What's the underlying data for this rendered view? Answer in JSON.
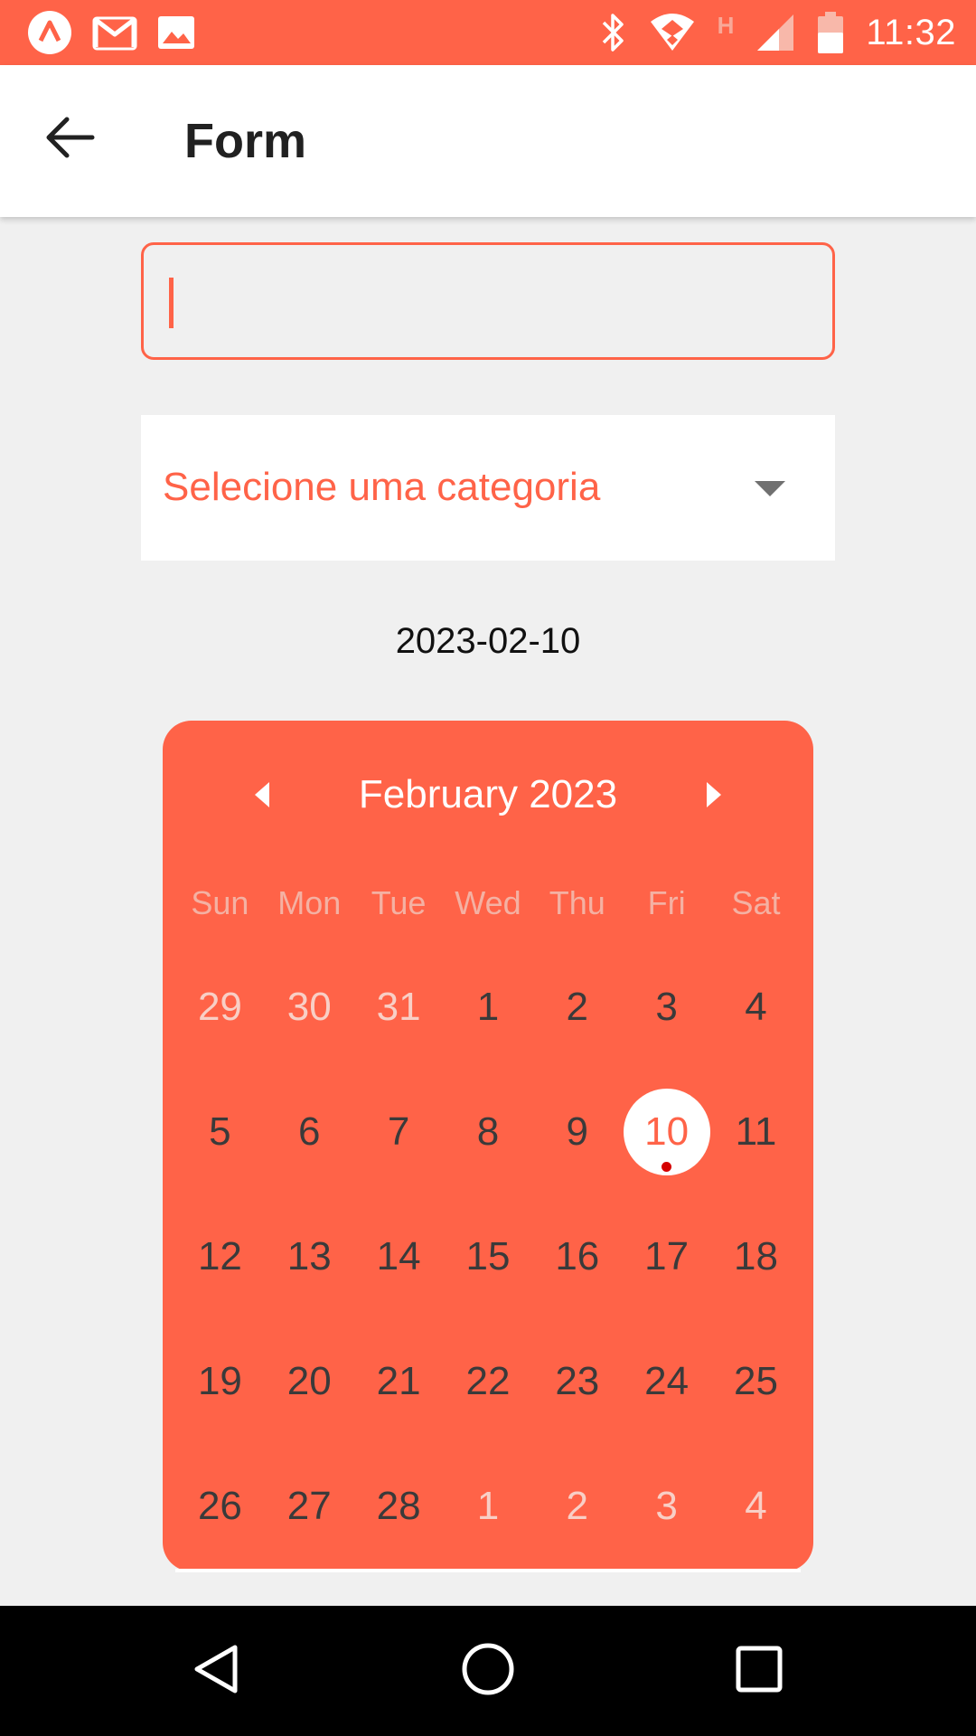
{
  "status_bar": {
    "time": "11:32",
    "left_icons": [
      "app-logo-icon",
      "gmail-icon",
      "gallery-icon"
    ],
    "right_icons": [
      "bluetooth-icon",
      "wifi-icon",
      "h-network-icon",
      "signal-icon",
      "battery-icon"
    ],
    "network_letter": "H"
  },
  "app_bar": {
    "title": "Form",
    "back_icon": "arrow-back-icon"
  },
  "form": {
    "text_input": {
      "value": "",
      "placeholder": ""
    },
    "category": {
      "label": "Selecione uma categoria"
    },
    "selected_date": "2023-02-10"
  },
  "calendar": {
    "month_title": "February 2023",
    "weekdays": [
      "Sun",
      "Mon",
      "Tue",
      "Wed",
      "Thu",
      "Fri",
      "Sat"
    ],
    "selected_day": "10",
    "weeks": [
      [
        "29",
        "30",
        "31",
        "1",
        "2",
        "3",
        "4"
      ],
      [
        "5",
        "6",
        "7",
        "8",
        "9",
        "10",
        "11"
      ],
      [
        "12",
        "13",
        "14",
        "15",
        "16",
        "17",
        "18"
      ],
      [
        "19",
        "20",
        "21",
        "22",
        "23",
        "24",
        "25"
      ],
      [
        "26",
        "27",
        "28",
        "1",
        "2",
        "3",
        "4"
      ]
    ]
  },
  "nav_bar": {
    "icons": [
      "back-triangle-icon",
      "home-circle-icon",
      "recents-square-icon"
    ]
  },
  "colors": {
    "accent": "#ff6348",
    "background": "#f0f0f0",
    "selected_dot": "#d50000"
  }
}
